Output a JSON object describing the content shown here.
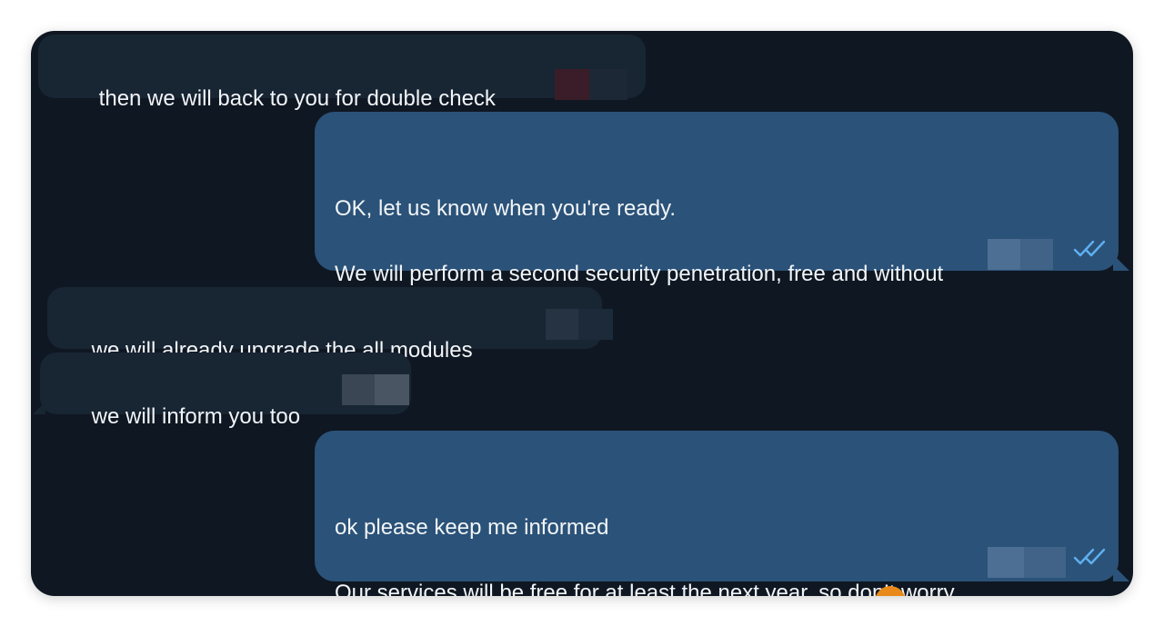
{
  "messages": [
    {
      "direction": "incoming",
      "text": "then we will back to you for double check"
    },
    {
      "direction": "outgoing",
      "text": "OK, let us know when you're ready.\n\nWe will perform a second security penetration, free and without\nmalicious intent.",
      "status": "read"
    },
    {
      "direction": "incoming",
      "text": "we will already upgrade the all modules"
    },
    {
      "direction": "incoming",
      "text": "we will inform you too"
    },
    {
      "direction": "outgoing",
      "text": "ok please keep me informed\n\nOur services will be free for at least the next year, so don’t worry",
      "status": "read"
    }
  ],
  "icons": {
    "read_status": "double-check-icon",
    "avatar": "avatar"
  },
  "colors": {
    "background": "#0f1722",
    "incoming_bubble": "#182533",
    "outgoing_bubble": "#2b5278",
    "text": "#f2f5f8",
    "read_check": "#5fb0f0",
    "avatar_peek": "#e88a1a"
  }
}
